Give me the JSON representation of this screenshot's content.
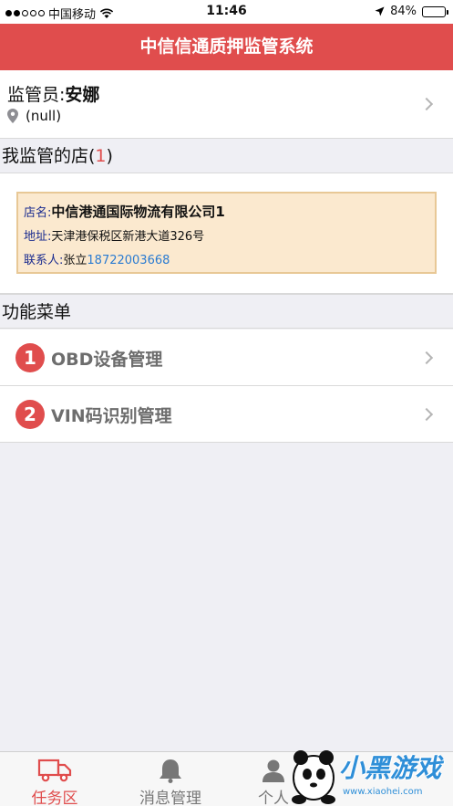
{
  "status_bar": {
    "carrier": "中国移动",
    "time": "11:46",
    "battery": "84%",
    "battery_level": 0.84
  },
  "header": {
    "title": "中信信通质押监管系统"
  },
  "supervisor": {
    "label": "监管员:",
    "name": "安娜",
    "location": "(null)"
  },
  "stores_section": {
    "title": "我监管的店(",
    "count": "1",
    "close": ")"
  },
  "store": {
    "name_label": "店名:",
    "name": "中信港通国际物流有限公司1",
    "address_label": "地址:",
    "address": "天津港保税区新港大道326号",
    "contact_label": "联系人:",
    "contact_name": "张立",
    "phone": "18722003668"
  },
  "menu_section": {
    "title": "功能菜单"
  },
  "menu": [
    {
      "badge": "1",
      "label": "OBD设备管理"
    },
    {
      "badge": "2",
      "label": "VIN码识别管理"
    }
  ],
  "tab_bar": {
    "tabs": [
      {
        "label": "任务区"
      },
      {
        "label": "消息管理"
      },
      {
        "label": "个人"
      }
    ]
  },
  "watermark": {
    "brand": "小黑游戏",
    "url": "www.xiaohei.com"
  },
  "colors": {
    "accent": "#e04d4d",
    "card_bg": "#fbe9cf",
    "link": "#2a7bd1"
  }
}
